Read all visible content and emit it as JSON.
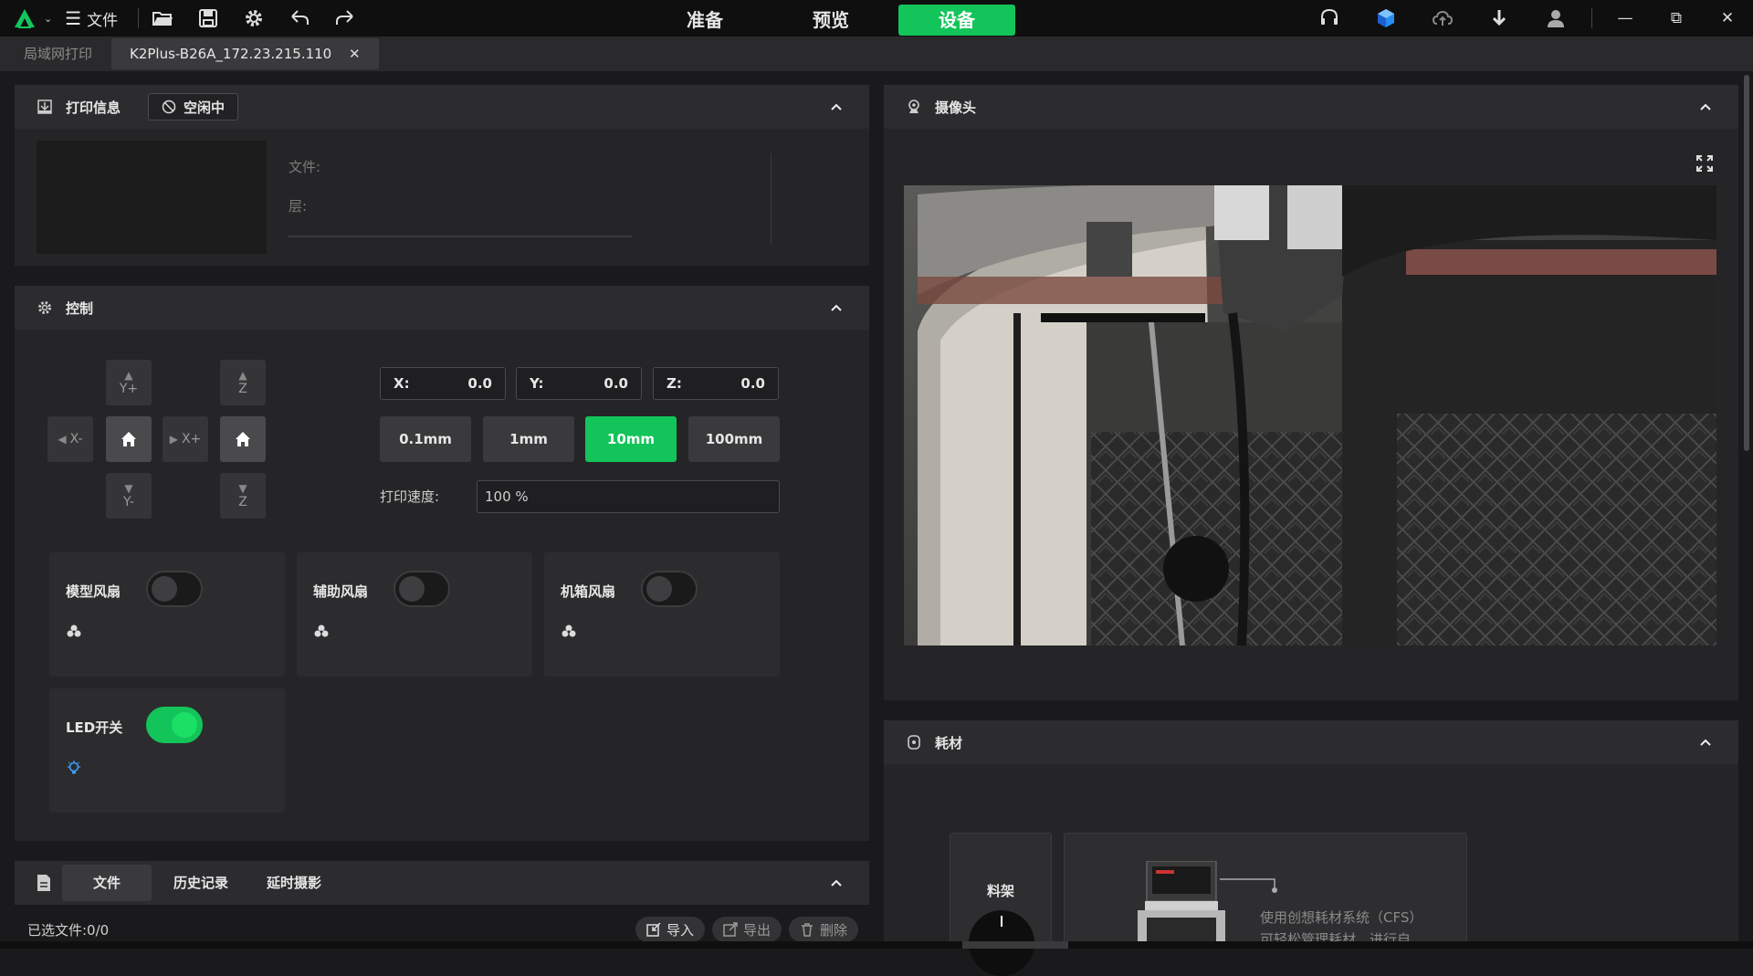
{
  "topbar": {
    "file_menu_label": "文件",
    "nav_tabs": [
      "准备",
      "预览",
      "设备"
    ],
    "active_nav": "设备",
    "accent_color": "#13c45a"
  },
  "file_tabs": [
    {
      "label": "局域网打印"
    },
    {
      "label": "K2Plus-B26A_172.23.215.110"
    }
  ],
  "print_info": {
    "title": "打印信息",
    "status": "空闲中",
    "file_label": "文件:",
    "layer_label": "层:"
  },
  "control": {
    "title": "控制",
    "jog": {
      "y_plus": "Y+",
      "y_minus": "Y-",
      "x_minus": "X-",
      "x_plus": "X+",
      "z_up": "Z",
      "z_down": "Z"
    },
    "coords": [
      {
        "axis": "X:",
        "value": "0.0"
      },
      {
        "axis": "Y:",
        "value": "0.0"
      },
      {
        "axis": "Z:",
        "value": "0.0"
      }
    ],
    "steps": [
      "0.1mm",
      "1mm",
      "10mm",
      "100mm"
    ],
    "active_step": "10mm",
    "speed_label": "打印速度:",
    "speed_value": "100 %",
    "fans": [
      {
        "label": "模型风扇",
        "on": false
      },
      {
        "label": "辅助风扇",
        "on": false
      },
      {
        "label": "机箱风扇",
        "on": false
      }
    ],
    "led": {
      "label": "LED开关",
      "on": true
    }
  },
  "files": {
    "tabs": [
      "文件",
      "历史记录",
      "延时摄影"
    ],
    "active_tab": "文件",
    "selected": "已选文件:0/0",
    "import_label": "导入",
    "export_label": "导出",
    "delete_label": "删除"
  },
  "camera": {
    "title": "摄像头"
  },
  "filament": {
    "title": "耗材",
    "rack_label": "料架",
    "cfs_line1": "使用创想耗材系统（CFS）",
    "cfs_line2": "可轻松管理耗材，进行自"
  }
}
